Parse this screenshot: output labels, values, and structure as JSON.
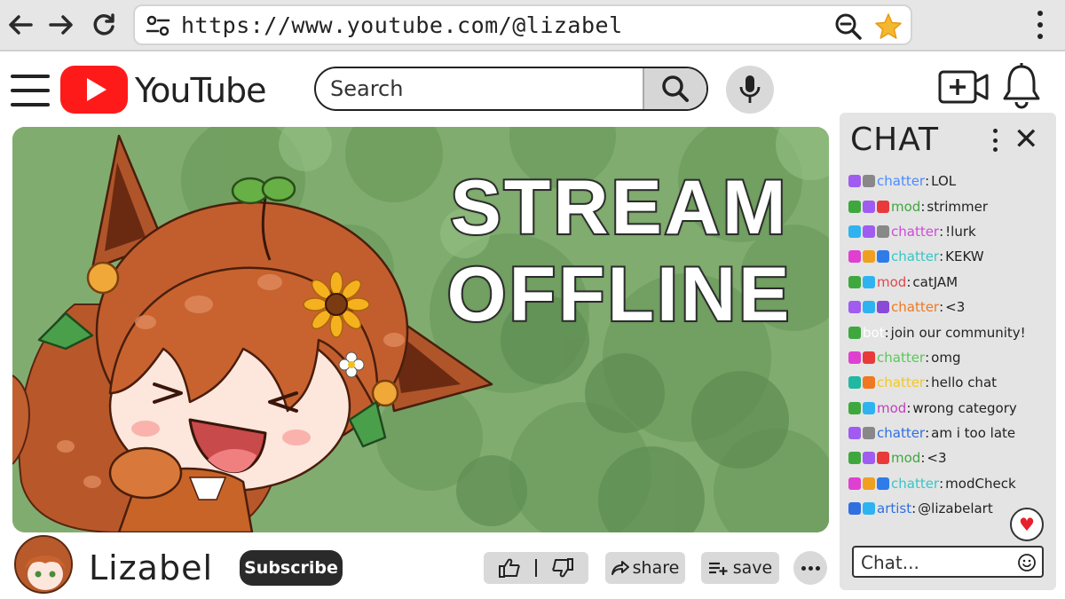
{
  "browser": {
    "url": "https://www.youtube.com/@lizabel",
    "icons": [
      "back-arrow-icon",
      "forward-arrow-icon",
      "reload-icon",
      "site-settings-icon",
      "zoom-out-icon",
      "bookmark-star-icon",
      "browser-menu-icon"
    ]
  },
  "header": {
    "logo_text": "YouTube",
    "search_placeholder": "Search",
    "icons": [
      "menu-icon",
      "search-icon",
      "mic-icon",
      "create-video-icon",
      "bell-icon"
    ]
  },
  "stream": {
    "line1": "STREAM",
    "line2": "OFFLINE"
  },
  "channel": {
    "name": "Lizabel",
    "subscribe_label": "Subscribe",
    "share_label": "share",
    "save_label": "save"
  },
  "chat": {
    "title": "CHAT",
    "input_placeholder": "Chat...",
    "messages": [
      {
        "user": "chatter",
        "text": "LOL",
        "color": "#4a8cff",
        "badges": [
          "#a05cf0",
          "#888888"
        ]
      },
      {
        "user": "mod",
        "text": "strimmer",
        "color": "#3ea83e",
        "badges": [
          "#3ea83e",
          "#a05cf0",
          "#e83a3a"
        ]
      },
      {
        "user": "chatter",
        "text": "!lurk",
        "color": "#d04ad8",
        "badges": [
          "#2fb3f0",
          "#a05cf0",
          "#888888"
        ]
      },
      {
        "user": "chatter",
        "text": "KEKW",
        "color": "#36c6c6",
        "badges": [
          "#e040d0",
          "#f0a020",
          "#2f7be8"
        ]
      },
      {
        "user": "mod",
        "text": "catJAM",
        "color": "#e0484e",
        "badges": [
          "#3ea83e",
          "#2fb3f0"
        ]
      },
      {
        "user": "chatter",
        "text": "<3",
        "color": "#f07820",
        "badges": [
          "#a05cf0",
          "#2fb3f0",
          "#8a4ad8"
        ]
      },
      {
        "user": "bot",
        "text": "join our community!",
        "color": "#ffffff",
        "badges": [
          "#3ea83e"
        ]
      },
      {
        "user": "chatter",
        "text": "omg",
        "color": "#5ac85a",
        "badges": [
          "#e040d0",
          "#e83a3a"
        ]
      },
      {
        "user": "chatter",
        "text": "hello chat",
        "color": "#f0c828",
        "badges": [
          "#20b8a0",
          "#f07820"
        ]
      },
      {
        "user": "mod",
        "text": "wrong category",
        "color": "#c040c0",
        "badges": [
          "#3ea83e",
          "#2fb3f0"
        ]
      },
      {
        "user": "chatter",
        "text": "am i too late",
        "color": "#2f6fe0",
        "badges": [
          "#a05cf0",
          "#888888"
        ]
      },
      {
        "user": "mod",
        "text": "<3",
        "color": "#3ea83e",
        "badges": [
          "#3ea83e",
          "#a05cf0",
          "#e83a3a"
        ]
      },
      {
        "user": "chatter",
        "text": "modCheck",
        "color": "#36c6c6",
        "badges": [
          "#e040d0",
          "#f0a020",
          "#2f7be8"
        ]
      },
      {
        "user": "artist",
        "text": "@lizabelart",
        "color": "#2f6fe0",
        "badges": [
          "#2f6fe0",
          "#2fb3f0"
        ]
      }
    ]
  },
  "colors": {
    "youtube_red": "#ff1a1a",
    "stream_green": "#7fae6e",
    "chat_bg": "#e4e4e4",
    "button_gray": "#d9d9d9"
  }
}
